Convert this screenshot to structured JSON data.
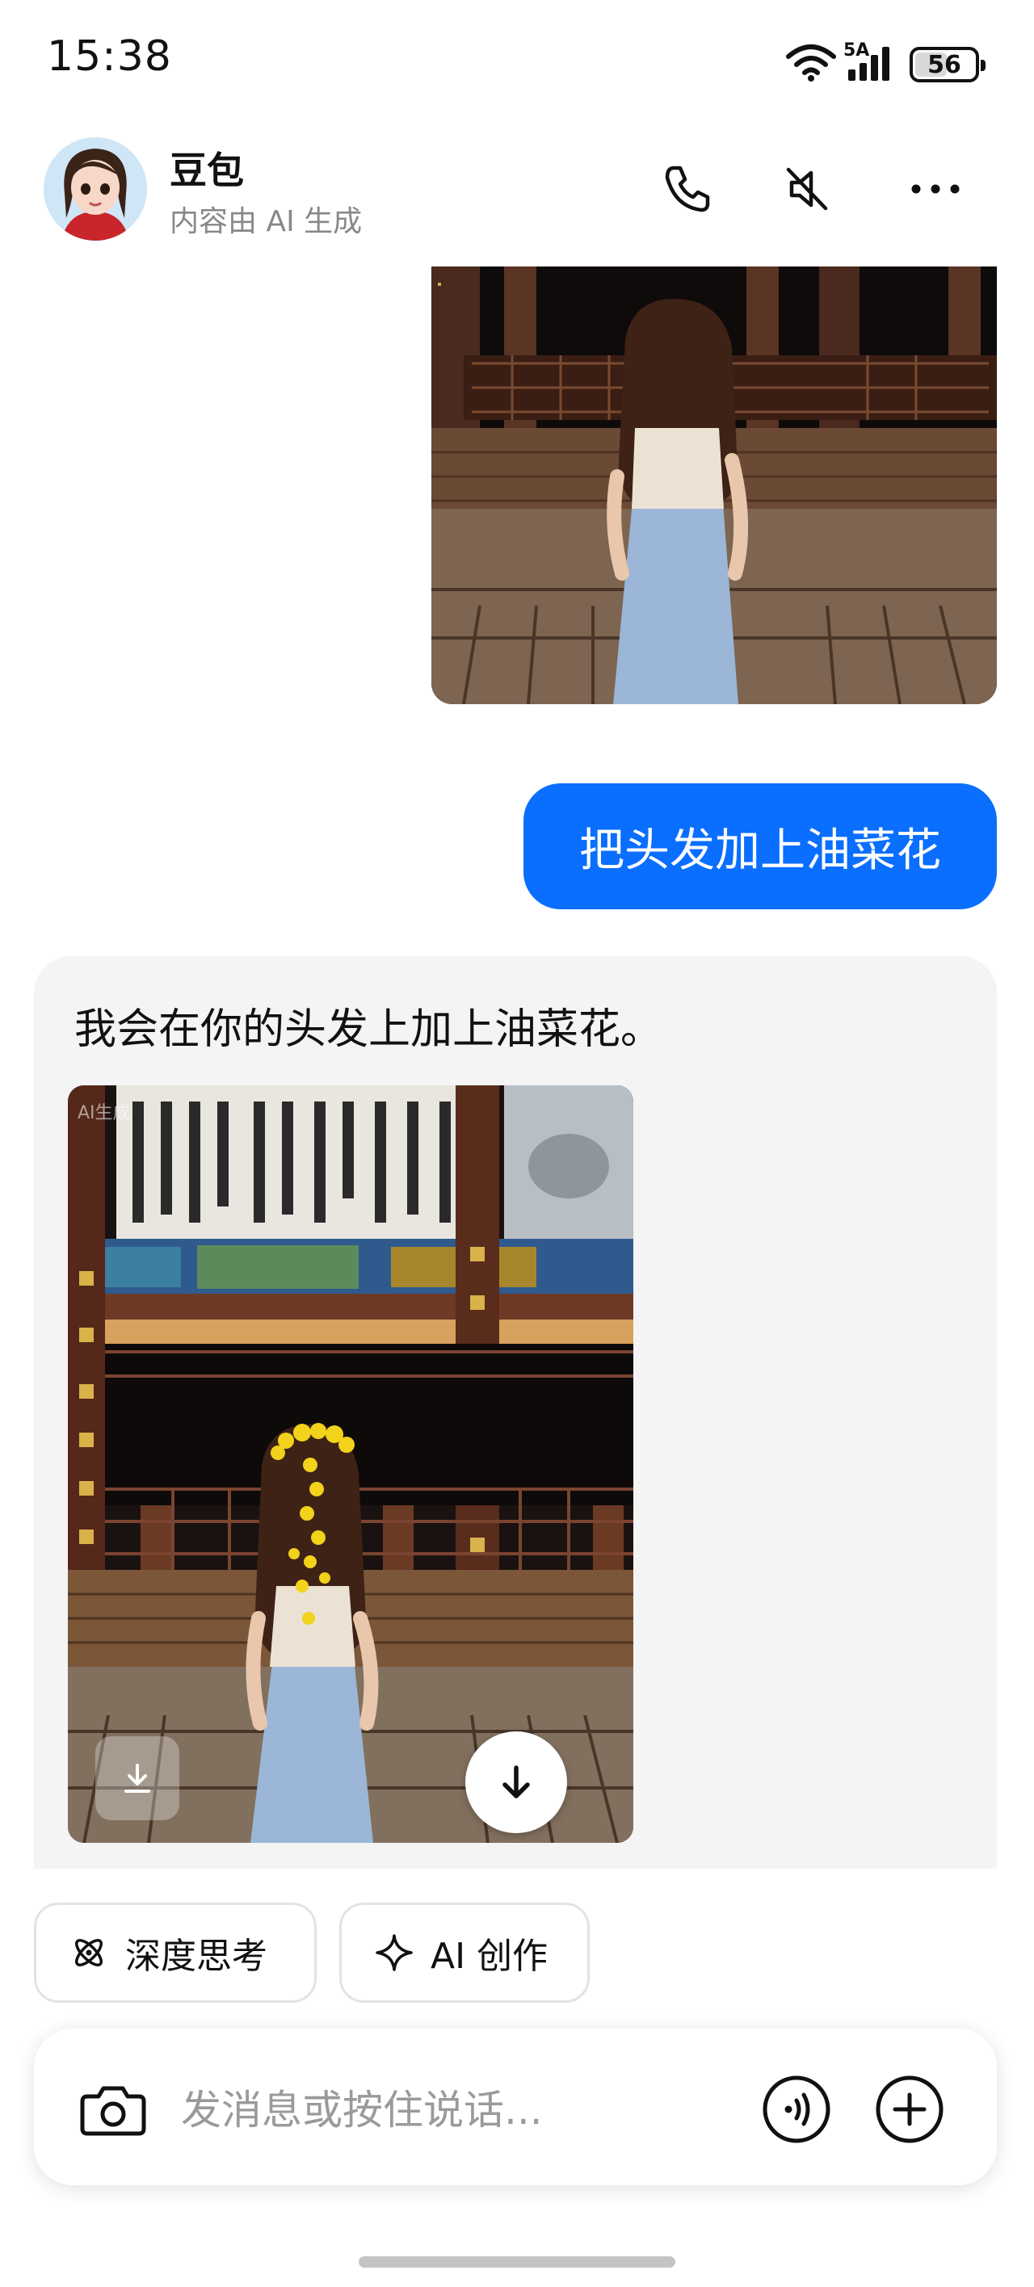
{
  "status_bar": {
    "time": "15:38",
    "network": "5A",
    "battery": "56"
  },
  "header": {
    "contact_name": "豆包",
    "subtitle": "内容由 AI 生成",
    "icons": [
      "phone-icon",
      "speaker-mute-icon",
      "more-icon"
    ]
  },
  "messages": [
    {
      "role": "user",
      "type": "image",
      "description_icon": "photo"
    },
    {
      "role": "user",
      "type": "text",
      "text": "把头发加上油菜花"
    },
    {
      "role": "assistant",
      "type": "text_image",
      "text": "我会在你的头发上加上油菜花。",
      "image_badge": "AI生成"
    }
  ],
  "chips": [
    {
      "label": "深度思考",
      "icon": "atom-icon"
    },
    {
      "label": "AI 创作",
      "icon": "sparkle-icon"
    }
  ],
  "composer": {
    "placeholder": "发消息或按住说话..."
  },
  "colors": {
    "accent": "#0A6EFF",
    "card_bg": "#f4f4f4"
  }
}
